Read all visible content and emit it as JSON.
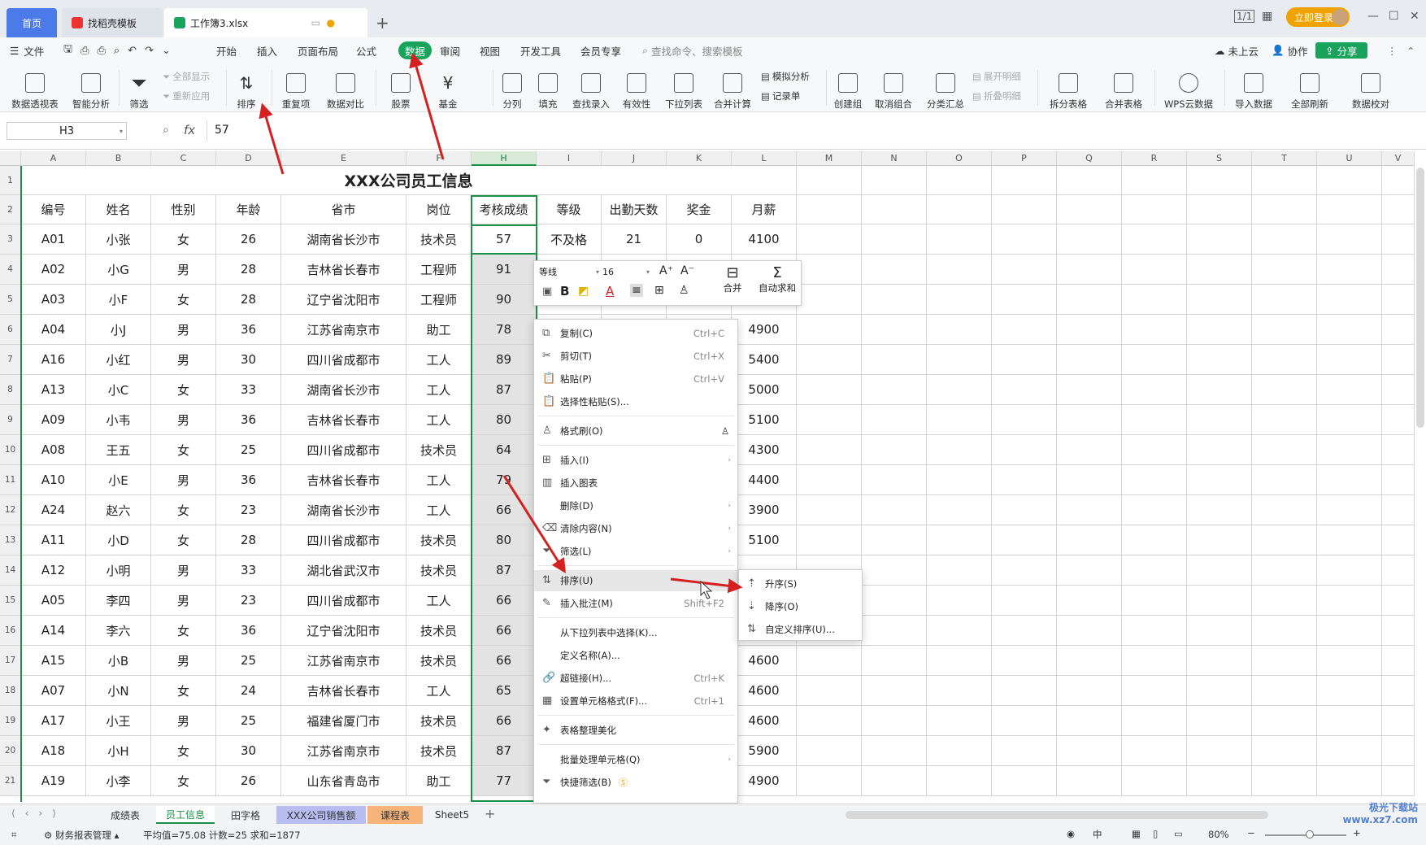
{
  "tabs": {
    "home": "首页",
    "template": "找稻壳模板",
    "file": "工作簿3.xlsx",
    "new_tab": "+"
  },
  "window": {
    "login": "立即登录",
    "layout_icon": "1/1",
    "apps_icon": "grid",
    "minimize": "—",
    "maximize": "☐",
    "close": "✕"
  },
  "menu": {
    "file": "文件",
    "items": [
      "开始",
      "插入",
      "页面布局",
      "公式",
      "数据",
      "审阅",
      "视图",
      "开发工具",
      "会员专享"
    ],
    "active": "数据",
    "search": "查找命令、搜索模板",
    "cloud": "未上云",
    "collab": "协作",
    "share": "分享"
  },
  "ribbon": {
    "pivot": "数据透视表",
    "smart": "智能分析",
    "filter": "筛选",
    "show_all": "全部显示",
    "reapply": "重新应用",
    "sort": "排序",
    "dup": "重复项",
    "compare": "数据对比",
    "stock": "股票",
    "fund": "基金",
    "split": "分列",
    "fill": "填充",
    "lookup": "查找录入",
    "valid": "有效性",
    "dropdown": "下拉列表",
    "merge_calc": "合并计算",
    "simulate": "模拟分析",
    "record": "记录单",
    "create_group": "创建组",
    "ungroup": "取消组合",
    "subtotal": "分类汇总",
    "expand": "展开明细",
    "collapse": "折叠明细",
    "split_table": "拆分表格",
    "merge_table": "合并表格",
    "wps_cloud": "WPS云数据",
    "import": "导入数据",
    "refresh": "全部刷新",
    "verify": "数据校对"
  },
  "formula": {
    "cell": "H3",
    "fx": "fx",
    "value": "57"
  },
  "columns": [
    "A",
    "B",
    "C",
    "D",
    "E",
    "F",
    "H",
    "I",
    "J",
    "K",
    "L",
    "M",
    "N",
    "O",
    "P",
    "Q",
    "R",
    "S",
    "T",
    "U",
    "V"
  ],
  "sheet": {
    "title": "XXX公司员工信息",
    "headers": [
      "编号",
      "姓名",
      "性别",
      "年龄",
      "省市",
      "岗位",
      "考核成绩",
      "等级",
      "出勤天数",
      "奖金",
      "月薪"
    ],
    "rows": [
      [
        "A01",
        "小张",
        "女",
        "26",
        "湖南省长沙市",
        "技术员",
        "57",
        "不及格",
        "21",
        "0",
        "4100"
      ],
      [
        "A02",
        "小G",
        "男",
        "28",
        "吉林省长春市",
        "工程师",
        "91",
        "",
        "",
        "",
        ""
      ],
      [
        "A03",
        "小F",
        "女",
        "28",
        "辽宁省沈阳市",
        "工程师",
        "90",
        "",
        "",
        "",
        ""
      ],
      [
        "A04",
        "小J",
        "男",
        "36",
        "江苏省南京市",
        "助工",
        "78",
        "",
        "",
        "",
        "4900"
      ],
      [
        "A16",
        "小红",
        "男",
        "30",
        "四川省成都市",
        "工人",
        "89",
        "",
        "",
        "",
        "5400"
      ],
      [
        "A13",
        "小C",
        "女",
        "33",
        "湖南省长沙市",
        "工人",
        "87",
        "",
        "",
        "",
        "5000"
      ],
      [
        "A09",
        "小韦",
        "男",
        "36",
        "吉林省长春市",
        "工人",
        "80",
        "",
        "",
        "",
        "5100"
      ],
      [
        "A08",
        "王五",
        "女",
        "25",
        "四川省成都市",
        "技术员",
        "64",
        "",
        "",
        "",
        "4300"
      ],
      [
        "A10",
        "小E",
        "男",
        "36",
        "吉林省长春市",
        "工人",
        "79",
        "",
        "",
        "",
        "4400"
      ],
      [
        "A24",
        "赵六",
        "女",
        "23",
        "湖南省长沙市",
        "工人",
        "66",
        "",
        "",
        "",
        "3900"
      ],
      [
        "A11",
        "小D",
        "女",
        "28",
        "四川省成都市",
        "技术员",
        "80",
        "",
        "",
        "",
        "5100"
      ],
      [
        "A12",
        "小明",
        "男",
        "33",
        "湖北省武汉市",
        "技术员",
        "87",
        "",
        "",
        "",
        ""
      ],
      [
        "A05",
        "李四",
        "男",
        "23",
        "四川省成都市",
        "工人",
        "66",
        "",
        "",
        "",
        ""
      ],
      [
        "A14",
        "李六",
        "女",
        "36",
        "辽宁省沈阳市",
        "技术员",
        "66",
        "",
        "",
        "",
        ""
      ],
      [
        "A15",
        "小B",
        "男",
        "25",
        "江苏省南京市",
        "技术员",
        "66",
        "",
        "",
        "",
        "4600"
      ],
      [
        "A07",
        "小N",
        "女",
        "24",
        "吉林省长春市",
        "工人",
        "65",
        "",
        "",
        "",
        "4600"
      ],
      [
        "A17",
        "小王",
        "男",
        "25",
        "福建省厦门市",
        "技术员",
        "66",
        "",
        "",
        "",
        "4600"
      ],
      [
        "A18",
        "小H",
        "女",
        "30",
        "江苏省南京市",
        "技术员",
        "87",
        "",
        "",
        "",
        "5900"
      ],
      [
        "A19",
        "小李",
        "女",
        "26",
        "山东省青岛市",
        "助工",
        "77",
        "",
        "",
        "",
        "4900"
      ]
    ]
  },
  "minitoolbar": {
    "font": "等线",
    "size": "16",
    "merge": "合并",
    "autosum": "自动求和",
    "bold": "B",
    "font_color": "A"
  },
  "context_menu": [
    {
      "label": "复制(C)",
      "key": "Ctrl+C",
      "icon": "copy-icon"
    },
    {
      "label": "剪切(T)",
      "key": "Ctrl+X",
      "icon": "cut-icon"
    },
    {
      "label": "粘贴(P)",
      "key": "Ctrl+V",
      "icon": "paste-icon"
    },
    {
      "label": "选择性粘贴(S)...",
      "key": "",
      "icon": "paste-special-icon"
    },
    {
      "label": "格式刷(O)",
      "key": "",
      "icon": "format-painter-icon"
    },
    {
      "label": "插入(I)",
      "key": "",
      "icon": "insert-icon",
      "sub": true
    },
    {
      "label": "插入图表",
      "key": "",
      "icon": "chart-icon"
    },
    {
      "label": "删除(D)",
      "key": "",
      "icon": "",
      "sub": true
    },
    {
      "label": "清除内容(N)",
      "key": "",
      "icon": "clear-icon",
      "sub": true
    },
    {
      "label": "筛选(L)",
      "key": "",
      "icon": "filter-icon",
      "sub": true
    },
    {
      "label": "排序(U)",
      "key": "",
      "icon": "sort-icon",
      "sub": true
    },
    {
      "label": "插入批注(M)",
      "key": "Shift+F2",
      "icon": "comment-icon"
    },
    {
      "label": "从下拉列表中选择(K)...",
      "key": "",
      "icon": ""
    },
    {
      "label": "定义名称(A)...",
      "key": "",
      "icon": ""
    },
    {
      "label": "超链接(H)...",
      "key": "Ctrl+K",
      "icon": "link-icon"
    },
    {
      "label": "设置单元格格式(F)...",
      "key": "Ctrl+1",
      "icon": "format-cells-icon"
    },
    {
      "label": "表格整理美化",
      "key": "",
      "icon": "beautify-icon"
    },
    {
      "label": "批量处理单元格(Q)",
      "key": "",
      "icon": "",
      "sub": true
    },
    {
      "label": "快捷筛选(B)",
      "key": "",
      "icon": "quick-filter-icon"
    }
  ],
  "sort_submenu": [
    "升序(S)",
    "降序(O)",
    "自定义排序(U)..."
  ],
  "sheet_tabs": [
    "成绩表",
    "员工信息",
    "田字格",
    "XXX公司销售额",
    "课程表",
    "Sheet5"
  ],
  "status": {
    "report": "财务报表管理",
    "stats": "平均值=75.08  计数=25  求和=1877",
    "zoom": "80%"
  },
  "watermark": "极光下载站  www.xz7.com",
  "colors": {
    "accent": "#1aa35b",
    "arrow": "#d42020",
    "tab_blue": "#4a7be8"
  }
}
